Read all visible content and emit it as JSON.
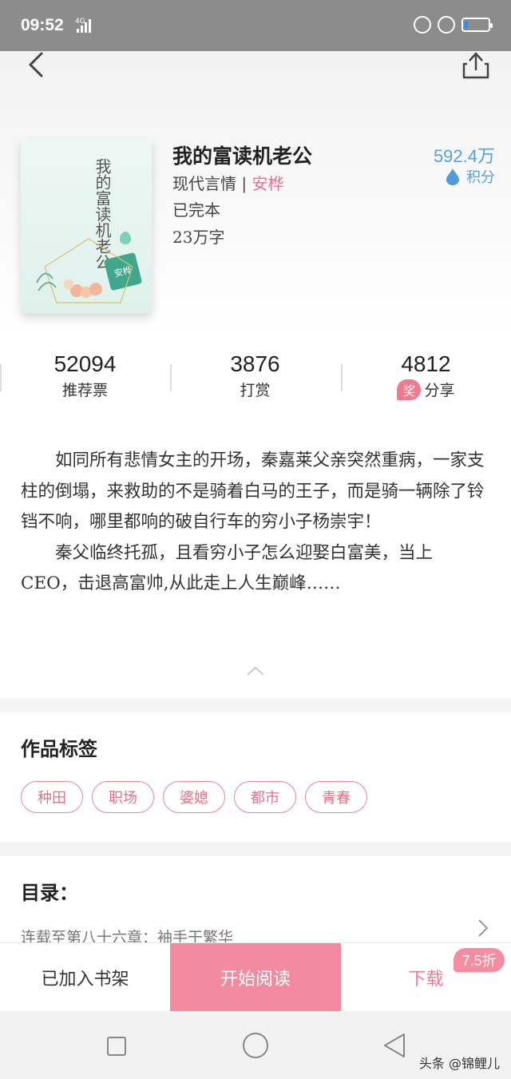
{
  "status_bar": {
    "time": "09:52",
    "network": "4G"
  },
  "header": {
    "back_icon": "back-arrow-icon",
    "share_icon": "share-icon"
  },
  "book": {
    "cover_title": "我的富读机老公",
    "title": "我的富读机老公",
    "category": "现代言情",
    "separator": "|",
    "author": "安桦",
    "status": "已完本",
    "word_count": "23万字",
    "points_value": "592.4万",
    "points_label": "积分"
  },
  "stats": [
    {
      "value": "52094",
      "label": "推荐票"
    },
    {
      "value": "3876",
      "label": "打赏"
    },
    {
      "value": "4812",
      "label": "分享",
      "badge": "奖"
    }
  ],
  "description": [
    "如同所有悲情女主的开场，秦嘉莱父亲突然重病，一家支柱的倒塌，来救助的不是骑着白马的王子，而是骑一辆除了铃铛不响，哪里都响的破自行车的穷小子杨崇宇！",
    "秦父临终托孤，且看穷小子怎么迎娶白富美，当上CEO，击退高富帅,从此走上人生巅峰……"
  ],
  "tags_section": {
    "title": "作品标签",
    "tags": [
      "种田",
      "职场",
      "婆媳",
      "都市",
      "青春"
    ]
  },
  "toc": {
    "title": "目录：",
    "latest": "连载至第八十六章：袖手干繁华"
  },
  "bottom_bar": {
    "shelf_label": "已加入书架",
    "read_label": "开始阅读",
    "download_label": "下载",
    "discount": "7.5折"
  },
  "watermark": "头条 @锦鲤儿",
  "colors": {
    "accent": "#f48aa0",
    "points_blue": "#5a9fd8",
    "author_pink": "#e8708c"
  }
}
